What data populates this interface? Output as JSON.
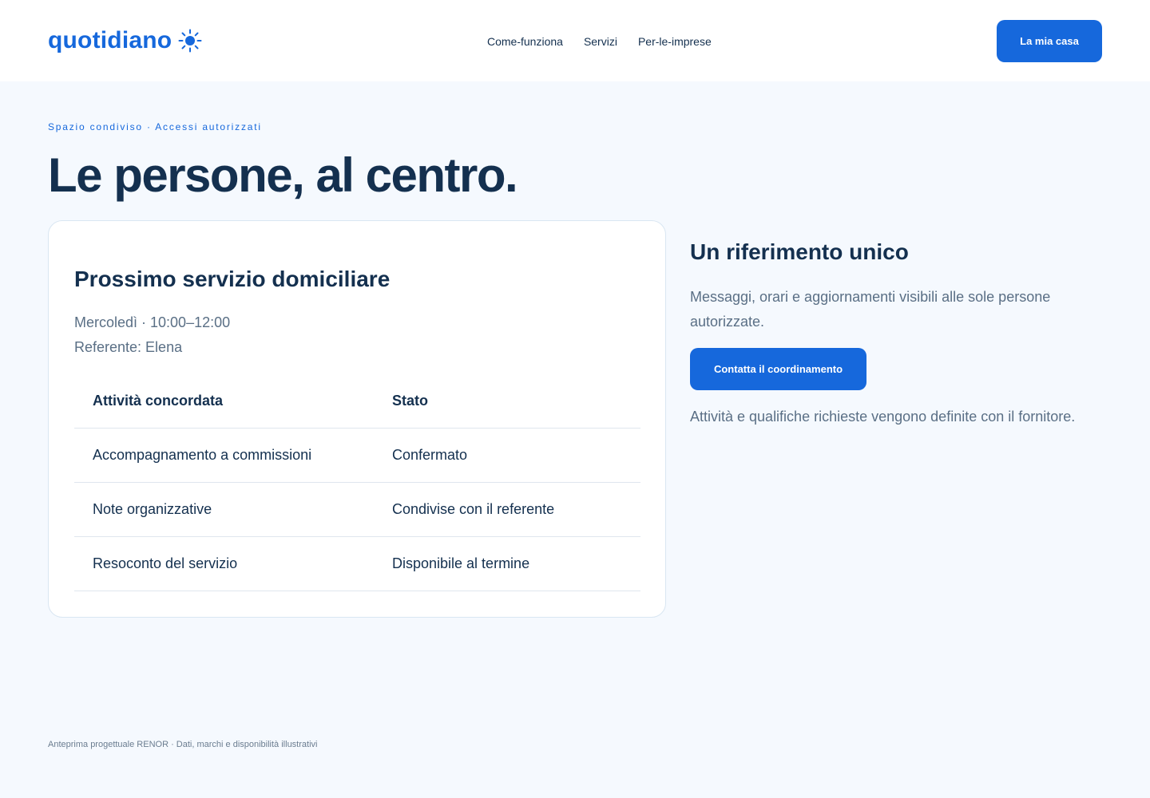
{
  "brand": {
    "name": "quotidiano",
    "icon": "sun-icon",
    "color": "#1668dc"
  },
  "nav": {
    "items": [
      {
        "label": "Come-funziona"
      },
      {
        "label": "Servizi"
      },
      {
        "label": "Per-le-imprese"
      }
    ],
    "cta_label": "La mia casa"
  },
  "hero": {
    "eyebrow": "Spazio condiviso · Accessi autorizzati",
    "title": "Le persone, al centro."
  },
  "card": {
    "title": "Prossimo servizio domiciliare",
    "schedule": "Mercoledì · 10:00–12:00",
    "contact": "Referente: Elena",
    "table": {
      "headers": [
        "Attività concordata",
        "Stato"
      ],
      "rows": [
        [
          "Accompagnamento a commissioni",
          "Confermato"
        ],
        [
          "Note organizzative",
          "Condivise con il referente"
        ],
        [
          "Resoconto del servizio",
          "Disponibile al termine"
        ]
      ]
    }
  },
  "side": {
    "title": "Un riferimento unico",
    "description": "Messaggi, orari e aggiornamenti visibili alle sole persone autorizzate.",
    "cta_label": "Contatta il coordinamento",
    "note": "Attività e qualifiche richieste vengono definite con il fornitore."
  },
  "footer": {
    "text": "Anteprima progettuale RENOR · Dati, marchi e disponibilità illustrativi"
  }
}
